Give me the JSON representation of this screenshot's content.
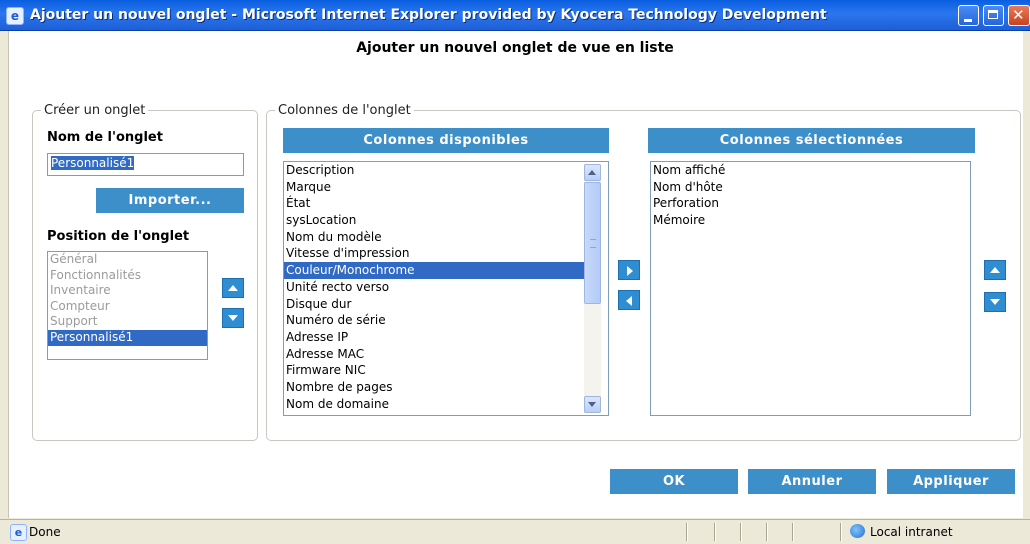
{
  "window": {
    "title": "Ajouter un nouvel onglet - Microsoft Internet Explorer provided by Kyocera Technology Development",
    "icon": "ie-icon"
  },
  "heading": "Ajouter un nouvel onglet de vue en liste",
  "create_tab": {
    "legend": "Créer un onglet",
    "name_label": "Nom de l'onglet",
    "name_value": "Personnalisé1",
    "import_button": "Importer...",
    "position_label": "Position de l'onglet",
    "positions": [
      "Général",
      "Fonctionnalités",
      "Inventaire",
      "Compteur",
      "Support",
      "Personnalisé1"
    ],
    "selected_position": "Personnalisé1"
  },
  "columns": {
    "legend": "Colonnes de l'onglet",
    "available_header": "Colonnes disponibles",
    "selected_header": "Colonnes sélectionnées",
    "available": [
      "Description",
      "Marque",
      "État",
      "sysLocation",
      "Nom du modèle",
      "Vitesse d'impression",
      "Couleur/Monochrome",
      "Unité recto verso",
      "Disque dur",
      "Numéro de série",
      "Adresse IP",
      "Adresse MAC",
      "Firmware NIC",
      "Nombre de pages",
      "Nom de domaine"
    ],
    "available_selected": "Couleur/Monochrome",
    "selected": [
      "Nom affiché",
      "Nom d'hôte",
      "Perforation",
      "Mémoire"
    ]
  },
  "buttons": {
    "ok": "OK",
    "cancel": "Annuler",
    "apply": "Appliquer"
  },
  "status": {
    "text": "Done",
    "zone": "Local intranet"
  }
}
